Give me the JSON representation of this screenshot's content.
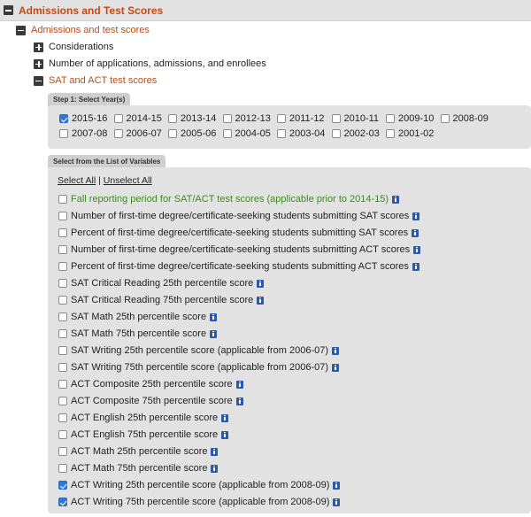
{
  "header": {
    "title": "Admissions and Test Scores"
  },
  "tree": {
    "admissions": "Admissions and test scores",
    "considerations": "Considerations",
    "applications": "Number of applications, admissions, and enrollees",
    "sat_act": "SAT and ACT test scores"
  },
  "step1": {
    "title": "Step 1: Select Year(s)",
    "years": [
      {
        "label": "2015-16",
        "checked": true
      },
      {
        "label": "2014-15",
        "checked": false
      },
      {
        "label": "2013-14",
        "checked": false
      },
      {
        "label": "2012-13",
        "checked": false
      },
      {
        "label": "2011-12",
        "checked": false
      },
      {
        "label": "2010-11",
        "checked": false
      },
      {
        "label": "2009-10",
        "checked": false
      },
      {
        "label": "2008-09",
        "checked": false
      },
      {
        "label": "2007-08",
        "checked": false
      },
      {
        "label": "2006-07",
        "checked": false
      },
      {
        "label": "2005-06",
        "checked": false
      },
      {
        "label": "2004-05",
        "checked": false
      },
      {
        "label": "2003-04",
        "checked": false
      },
      {
        "label": "2002-03",
        "checked": false
      },
      {
        "label": "2001-02",
        "checked": false
      }
    ]
  },
  "variables": {
    "title": "Select from the List of Variables",
    "select_all": "Select All",
    "separator": "|",
    "unselect_all": "Unselect All",
    "items": [
      {
        "label": "Fall reporting period for SAT/ACT test scores (applicable prior to 2014-15)",
        "checked": false,
        "highlight": true
      },
      {
        "label": "Number of first-time degree/certificate-seeking students submitting SAT scores",
        "checked": false
      },
      {
        "label": "Percent of first-time degree/certificate-seeking students submitting SAT scores",
        "checked": false
      },
      {
        "label": "Number of first-time degree/certificate-seeking students submitting ACT scores",
        "checked": false
      },
      {
        "label": "Percent of first-time degree/certificate-seeking students submitting ACT scores",
        "checked": false
      },
      {
        "label": "SAT Critical Reading 25th percentile score",
        "checked": false
      },
      {
        "label": "SAT Critical Reading 75th percentile score",
        "checked": false
      },
      {
        "label": "SAT Math 25th percentile score",
        "checked": false
      },
      {
        "label": "SAT Math 75th percentile score",
        "checked": false
      },
      {
        "label": "SAT Writing 25th percentile score (applicable from 2006-07)",
        "checked": false
      },
      {
        "label": "SAT Writing 75th percentile score (applicable from 2006-07)",
        "checked": false
      },
      {
        "label": "ACT Composite 25th percentile score",
        "checked": false
      },
      {
        "label": "ACT Composite 75th percentile score",
        "checked": false
      },
      {
        "label": "ACT English 25th percentile score",
        "checked": false
      },
      {
        "label": "ACT English 75th percentile score",
        "checked": false
      },
      {
        "label": "ACT Math 25th percentile score",
        "checked": false
      },
      {
        "label": "ACT Math 75th percentile score",
        "checked": false
      },
      {
        "label": "ACT Writing 25th percentile score (applicable from 2008-09)",
        "checked": true
      },
      {
        "label": "ACT Writing 75th percentile score (applicable from 2008-09)",
        "checked": true
      }
    ]
  },
  "colors": {
    "accent_orange": "#c14b13",
    "highlight_green": "#3d8b1f",
    "checkbox_blue": "#2f78d6",
    "info_blue": "#2a5aa8"
  }
}
